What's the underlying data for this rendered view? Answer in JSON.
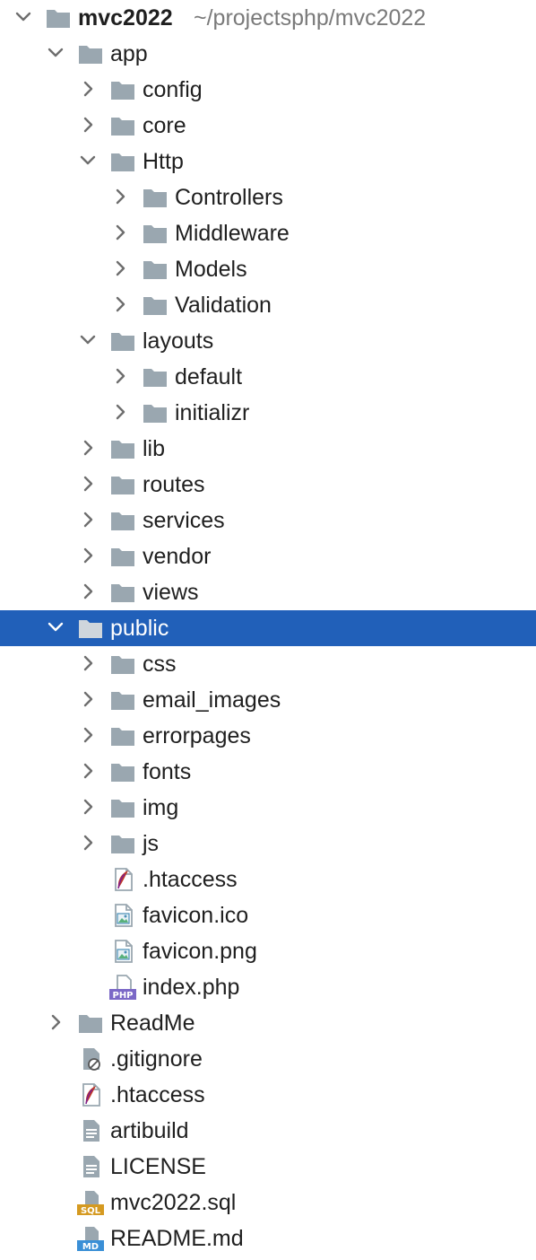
{
  "root": {
    "label": "mvc2022",
    "path": "~/projectsphp/mvc2022"
  },
  "items": [
    {
      "label": "app",
      "depth": 1,
      "type": "folder",
      "state": "expanded"
    },
    {
      "label": "config",
      "depth": 2,
      "type": "folder",
      "state": "collapsed"
    },
    {
      "label": "core",
      "depth": 2,
      "type": "folder",
      "state": "collapsed"
    },
    {
      "label": "Http",
      "depth": 2,
      "type": "folder",
      "state": "expanded"
    },
    {
      "label": "Controllers",
      "depth": 3,
      "type": "folder",
      "state": "collapsed"
    },
    {
      "label": "Middleware",
      "depth": 3,
      "type": "folder",
      "state": "collapsed"
    },
    {
      "label": "Models",
      "depth": 3,
      "type": "folder",
      "state": "collapsed"
    },
    {
      "label": "Validation",
      "depth": 3,
      "type": "folder",
      "state": "collapsed"
    },
    {
      "label": "layouts",
      "depth": 2,
      "type": "folder",
      "state": "expanded"
    },
    {
      "label": "default",
      "depth": 3,
      "type": "folder",
      "state": "collapsed"
    },
    {
      "label": "initializr",
      "depth": 3,
      "type": "folder",
      "state": "collapsed"
    },
    {
      "label": "lib",
      "depth": 2,
      "type": "folder",
      "state": "collapsed"
    },
    {
      "label": "routes",
      "depth": 2,
      "type": "folder",
      "state": "collapsed"
    },
    {
      "label": "services",
      "depth": 2,
      "type": "folder",
      "state": "collapsed"
    },
    {
      "label": "vendor",
      "depth": 2,
      "type": "folder",
      "state": "collapsed"
    },
    {
      "label": "views",
      "depth": 2,
      "type": "folder",
      "state": "collapsed"
    },
    {
      "label": "public",
      "depth": 1,
      "type": "folder",
      "state": "expanded",
      "selected": true
    },
    {
      "label": "css",
      "depth": 2,
      "type": "folder",
      "state": "collapsed"
    },
    {
      "label": "email_images",
      "depth": 2,
      "type": "folder",
      "state": "collapsed"
    },
    {
      "label": "errorpages",
      "depth": 2,
      "type": "folder",
      "state": "collapsed"
    },
    {
      "label": "fonts",
      "depth": 2,
      "type": "folder",
      "state": "collapsed"
    },
    {
      "label": "img",
      "depth": 2,
      "type": "folder",
      "state": "collapsed"
    },
    {
      "label": "js",
      "depth": 2,
      "type": "folder",
      "state": "collapsed"
    },
    {
      "label": ".htaccess",
      "depth": 2,
      "type": "file",
      "icon": "apache-feather-icon"
    },
    {
      "label": "favicon.ico",
      "depth": 2,
      "type": "file",
      "icon": "image-file-icon"
    },
    {
      "label": "favicon.png",
      "depth": 2,
      "type": "file",
      "icon": "image-file-icon"
    },
    {
      "label": "index.php",
      "depth": 2,
      "type": "file",
      "icon": "php-file-icon",
      "badge": "PHP"
    },
    {
      "label": "ReadMe",
      "depth": 1,
      "type": "folder",
      "state": "collapsed"
    },
    {
      "label": ".gitignore",
      "depth": 1,
      "type": "file",
      "icon": "ignore-file-icon"
    },
    {
      "label": ".htaccess",
      "depth": 1,
      "type": "file",
      "icon": "apache-feather-icon"
    },
    {
      "label": "artibuild",
      "depth": 1,
      "type": "file",
      "icon": "text-file-icon"
    },
    {
      "label": "LICENSE",
      "depth": 1,
      "type": "file",
      "icon": "text-file-icon"
    },
    {
      "label": "mvc2022.sql",
      "depth": 1,
      "type": "file",
      "icon": "sql-file-icon",
      "badge": "SQL"
    },
    {
      "label": "README.md",
      "depth": 1,
      "type": "file",
      "icon": "markdown-file-icon",
      "badge": "MD"
    }
  ],
  "colors": {
    "selection": "#2160b9",
    "folder": "#9aa7b0",
    "chevron": "#6e6e6e",
    "path_text": "#7a7a7a",
    "php_badge": "#7b68c7",
    "sql_badge": "#d59a21",
    "md_badge": "#3a8fd6"
  }
}
